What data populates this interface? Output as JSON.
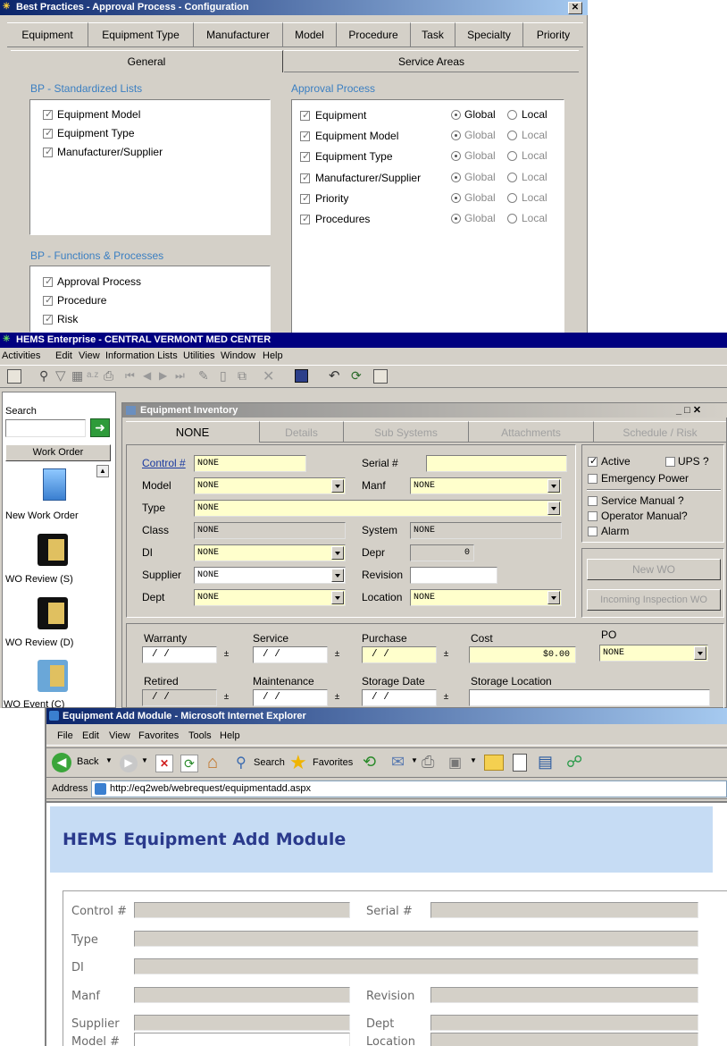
{
  "bp": {
    "title": "Best Practices - Approval Process - Configuration",
    "close_glyph": "✕",
    "tabs": [
      "Equipment",
      "Equipment Type",
      "Manufacturer",
      "Model",
      "Procedure",
      "Task",
      "Specialty",
      "Priority"
    ],
    "subtabs": [
      "General",
      "Service Areas"
    ],
    "std_lists_title": "BP - Standardized Lists",
    "std_lists": [
      "Equipment Model",
      "Equipment Type",
      "Manufacturer/Supplier"
    ],
    "functions_title": "BP - Functions & Processes",
    "functions": [
      "Approval Process",
      "Procedure",
      "Risk"
    ],
    "approval_title": "Approval Process",
    "approval_items": [
      "Equipment",
      "Equipment Model",
      "Equipment Type",
      "Manufacturer/Supplier",
      "Priority",
      "Procedures"
    ],
    "global_label": "Global",
    "local_label": "Local"
  },
  "hems": {
    "title": "HEMS Enterprise - CENTRAL VERMONT MED CENTER",
    "menu": [
      "Activities",
      "Edit",
      "View",
      "Information Lists",
      "Utilities",
      "Window",
      "Help"
    ],
    "sidebar": {
      "search_label": "Search",
      "work_order_button": "Work Order",
      "items": [
        "New Work Order",
        "WO Review (S)",
        "WO Review (D)",
        "WO Event (C)"
      ]
    },
    "inv": {
      "title": "Equipment Inventory",
      "window_controls": "_ □ ✕",
      "tabs": [
        "NONE",
        "Details",
        "Sub Systems",
        "Attachments",
        "Schedule / Risk"
      ],
      "control_label": "Control #",
      "control_value": "NONE",
      "serial_label": "Serial #",
      "serial_value": "",
      "model_label": "Model",
      "model_value": "NONE",
      "manf_label": "Manf",
      "manf_value": "NONE",
      "type_label": "Type",
      "type_value": "NONE",
      "class_label": "Class",
      "class_value": "NONE",
      "system_label": "System",
      "system_value": "NONE",
      "di_label": "DI",
      "di_value": "NONE",
      "depr_label": "Depr",
      "depr_value": "0",
      "supplier_label": "Supplier",
      "supplier_value": "NONE",
      "revision_label": "Revision",
      "revision_value": "",
      "dept_label": "Dept",
      "dept_value": "NONE",
      "location_label": "Location",
      "location_value": "NONE",
      "checks": [
        "Active",
        "UPS ?",
        "Emergency Power",
        "Service Manual ?",
        "Operator Manual?",
        "Alarm"
      ],
      "new_wo_button": "New WO",
      "incoming_button": "Incoming Inspection WO",
      "warranty_label": "Warranty",
      "service_label": "Service",
      "purchase_label": "Purchase",
      "cost_label": "Cost",
      "cost_value": "$0.00",
      "po_label": "PO",
      "po_value": "NONE",
      "retired_label": "Retired",
      "maintenance_label": "Maintenance",
      "storage_date_label": "Storage Date",
      "storage_location_label": "Storage Location",
      "date_placeholder": "/ /"
    }
  },
  "ie": {
    "title": "Equipment Add Module - Microsoft Internet Explorer",
    "menu": [
      "File",
      "Edit",
      "View",
      "Favorites",
      "Tools",
      "Help"
    ],
    "back_label": "Back",
    "search_label": "Search",
    "favorites_label": "Favorites",
    "address_label": "Address",
    "address_value": "http://eq2web/webrequest/equipmentadd.aspx",
    "page_heading": "HEMS Equipment Add Module",
    "form_left": [
      "Control #",
      "Type",
      "DI",
      "Manf",
      "Supplier",
      "Model #"
    ],
    "form_right": [
      "Serial #",
      "Revision",
      "Dept",
      "Location"
    ]
  },
  "colors": {
    "title_blue": "#0a246a",
    "title_blue2": "#a6caf0",
    "hems_title": "#000080",
    "heading_blue": "#2a3a8c",
    "banner": "#c6dcf4"
  }
}
